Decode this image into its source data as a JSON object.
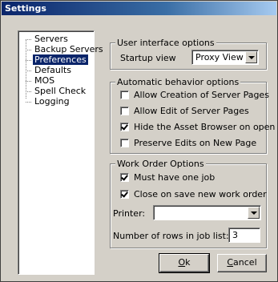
{
  "window": {
    "title": "Settings"
  },
  "tree": {
    "items": [
      {
        "label": "Servers",
        "indent": 0,
        "selected": false
      },
      {
        "label": "Backup Servers",
        "indent": 0,
        "selected": false
      },
      {
        "label": "Preferences",
        "indent": 0,
        "selected": true
      },
      {
        "label": "Defaults",
        "indent": 0,
        "selected": false
      },
      {
        "label": "MOS",
        "indent": 0,
        "selected": false
      },
      {
        "label": "Spell Check",
        "indent": 0,
        "selected": false
      },
      {
        "label": "Logging",
        "indent": 0,
        "selected": false
      }
    ]
  },
  "ui_options": {
    "title": "User interface options",
    "startup_label": "Startup view",
    "startup_value": "Proxy View"
  },
  "auto_options": {
    "title": "Automatic behavior options",
    "items": [
      {
        "label": "Allow Creation of Server Pages",
        "checked": false
      },
      {
        "label": "Allow Edit of Server Pages",
        "checked": false
      },
      {
        "label": "Hide the Asset Browser on open",
        "checked": true
      },
      {
        "label": "Preserve Edits on New Page",
        "checked": false
      }
    ]
  },
  "work_order": {
    "title": "Work Order Options",
    "items": [
      {
        "label": "Must have one job",
        "checked": true
      },
      {
        "label": "Close on save new work order",
        "checked": true
      }
    ],
    "printer_label": "Printer:",
    "printer_value": "",
    "rows_label": "Number of rows in job list:",
    "rows_value": "3"
  },
  "buttons": {
    "ok_mnemonic": "O",
    "ok_rest": "k",
    "cancel_mnemonic": "C",
    "cancel_rest": "ancel"
  }
}
